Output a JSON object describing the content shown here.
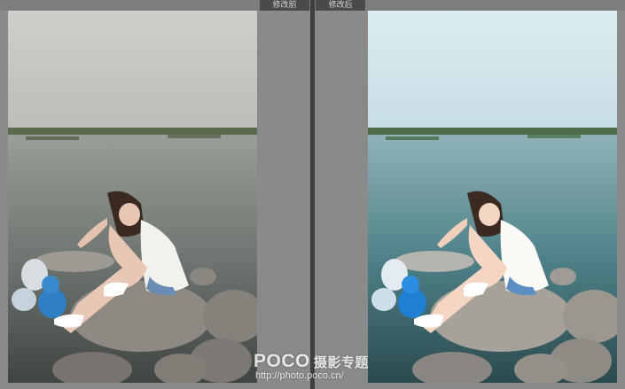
{
  "labels": {
    "before": "修改前",
    "after": "修改后"
  },
  "watermark": {
    "brand": "POCO",
    "tagline": "摄影专题",
    "url": "http://photo.poco.cn/"
  },
  "colors": {
    "divider": "#3f3f3f",
    "background": "#8a8a8a",
    "before_sky": "#c9c8c3",
    "after_sky": "#d2e6ec",
    "before_water": "#6e7470",
    "after_water": "#4d7f86"
  }
}
